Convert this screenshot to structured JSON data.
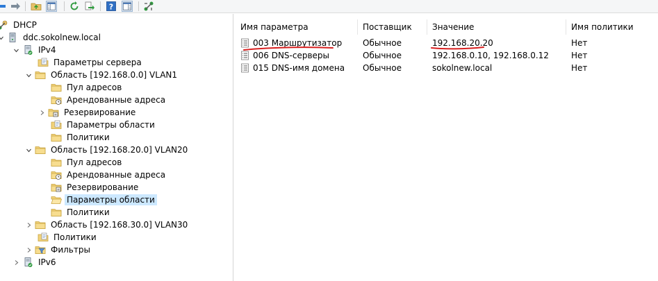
{
  "tree": {
    "root": "DHCP",
    "server": "ddc.sokolnew.local",
    "ipv4": "IPv4",
    "server_options": "Параметры сервера",
    "scope1": {
      "label": "Область [192.168.0.0] VLAN1",
      "pool": "Пул адресов",
      "leases": "Арендованные адреса",
      "reservations": "Резервирование",
      "options": "Параметры области",
      "policies": "Политики"
    },
    "scope20": {
      "label": "Область [192.168.20.0] VLAN20",
      "pool": "Пул адресов",
      "leases": "Арендованные адреса",
      "reservations": "Резервирование",
      "options": "Параметры области",
      "policies": "Политики"
    },
    "scope30": "Область [192.168.30.0] VLAN30",
    "policies": "Политики",
    "filters": "Фильтры",
    "ipv6": "IPv6"
  },
  "list": {
    "columns": [
      "Имя параметра",
      "Поставщик",
      "Значение",
      "Имя политики"
    ],
    "rows": [
      {
        "name": "003 Маршрутизатор",
        "vendor": "Обычное",
        "value": "192.168.20.20",
        "policy": "Нет"
      },
      {
        "name": "006 DNS-серверы",
        "vendor": "Обычное",
        "value": "192.168.0.10, 192.168.0.12",
        "policy": "Нет"
      },
      {
        "name": "015 DNS-имя домена",
        "vendor": "Обычное",
        "value": "sokolnew.local",
        "policy": "Нет"
      }
    ]
  },
  "colors": {
    "selection": "#cce8ff",
    "annotation": "#d81f1f",
    "folder": "#e8c26a"
  },
  "icons": {
    "back": "arrow-left-icon",
    "forward": "arrow-right-icon"
  }
}
